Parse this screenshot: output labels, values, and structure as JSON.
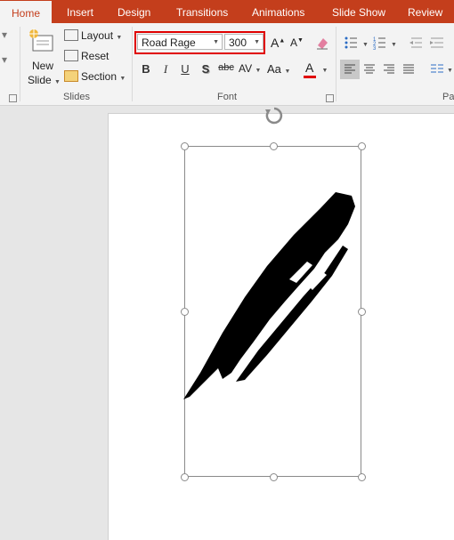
{
  "tabs": [
    "Home",
    "Insert",
    "Design",
    "Transitions",
    "Animations",
    "Slide Show",
    "Review"
  ],
  "slides_group": {
    "new_slide_label_line1": "New",
    "new_slide_label_line2": "Slide",
    "layout_label": "Layout",
    "reset_label": "Reset",
    "section_label": "Section",
    "group_label": "Slides"
  },
  "font_group": {
    "font_name": "Road Rage",
    "font_size": "300",
    "bold": "B",
    "italic": "I",
    "underline": "U",
    "shadow": "S",
    "strike": "abc",
    "spacing": "AV",
    "change_case": "Aa",
    "font_color": "A",
    "group_label": "Font"
  },
  "paragraph_group_label": "Pa",
  "colors": {
    "accent": "#c43e1c",
    "highlight_outline": "#e00000",
    "font_color_bar": "#e00000"
  }
}
